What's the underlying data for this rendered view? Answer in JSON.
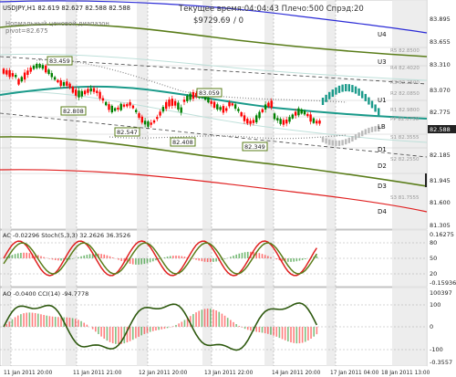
{
  "header": {
    "symbol_line": "USDJPY,H1  82.619 82.627 82.588 82.588",
    "indicator_label": "Нормальный ценовой диапазон",
    "pivot_label": "pivot=82.675",
    "account_line": "Текущее время:04:04:43 Плечо:500 Спрэд:20",
    "balance_line": "$9729.69",
    "balance_suffix": "/ 0"
  },
  "level_labels": {
    "u4": "U4",
    "u3": "U3",
    "u1": "U1",
    "lb": "LB",
    "d1": "D1",
    "d2": "D2",
    "d3": "D3",
    "d4": "D4",
    "r5": "R5 82.8500",
    "r4": "R4 82.4020",
    "r3": "R3 82.2500",
    "r2": "R2 82.0850",
    "r1": "R1 82.9800",
    "pp": "PP 82.6750",
    "s1": "S1 82.3555",
    "s2": "S2 82.2550",
    "s3": "S3 81.7555"
  },
  "price_axis": [
    "83.895",
    "83.655",
    "83.310",
    "83.070",
    "82.775",
    "82.588",
    "82.185",
    "81.945",
    "81.600",
    "81.305"
  ],
  "price_boxes": [
    "83.459",
    "82.808",
    "82.547",
    "82.408",
    "83.059",
    "82.349"
  ],
  "ac_stoch": {
    "label": "AC -0.02296   Stoch(5,3,3) 32.2626 36.3526",
    "axis": [
      "0.16275",
      "80",
      "50",
      "20",
      "-0.15936"
    ]
  },
  "ao_cci": {
    "label": "AO -0.0400   CCI(14) -94.7778",
    "axis": [
      "100397",
      "100",
      "0",
      "-100",
      "-0.3557"
    ]
  },
  "time_axis": [
    "11 Jan 2011 20:00",
    "11 Jan 2011 21:00",
    "12 Jan 2011 20:00",
    "13 Jan 2011 22:00",
    "14 Jan 2011 20:00",
    "17 Jan 2011 04:00",
    "18 Jan 2011 13:00"
  ],
  "colors": {
    "bull": "#008000",
    "bear": "#ff0000",
    "teal": "#1a9a8a",
    "olive": "#5a7d1a",
    "blue": "#2b2bd6",
    "red": "#e02020"
  }
}
